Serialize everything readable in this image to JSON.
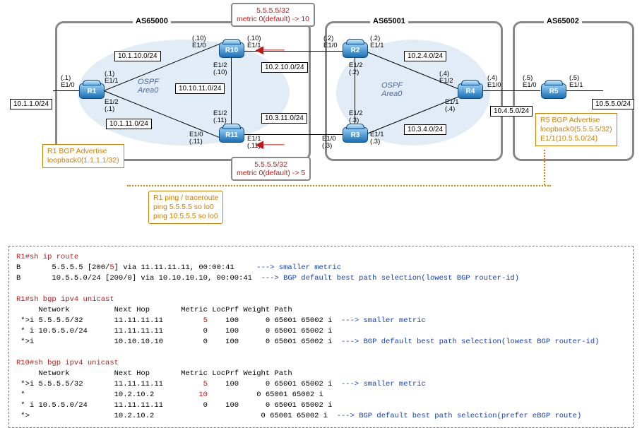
{
  "as": {
    "a": "AS65000",
    "b": "AS65001",
    "c": "AS65002"
  },
  "routers": {
    "r1": "R1",
    "r2": "R2",
    "r3": "R3",
    "r4": "R4",
    "r5": "R5",
    "r10": "R10",
    "r11": "R11"
  },
  "ospf": {
    "a": "OSPF\nArea0",
    "b": "OSPF\nArea0"
  },
  "nets": {
    "n1": "10.1.1.0/24",
    "n2": "10.1.10.0/24",
    "n3": "10.1.11.0/24",
    "n4": "10.10.11.0/24",
    "n5": "10.2.10.0/24",
    "n6": "10.3.11.0/24",
    "n7": "10.2.4.0/24",
    "n8": "10.3.4.0/24",
    "n9": "10.4.5.0/24",
    "n10": "10.5.5.0/24"
  },
  "ifaces": {
    "r1e10": "(.1)\nE1/0",
    "r1e11": "(.1)\nE1/1",
    "r1e12": "E1/2\n(.1)",
    "r10e10": "(.10)\nE1/0",
    "r10e11": "(.10)\nE1/1",
    "r10e12": "E1/2\n(.10)",
    "r11e10": "E1/0\n(.11)",
    "r11e11": "E1/1\n(.11)",
    "r11e12": "E1/2\n(.11)",
    "r2e10": "(.2)\nE1/0",
    "r2e11": "(.2)\nE1/1",
    "r2e12": "E1/2\n(.2)",
    "r3e10": "E1/0\n(.3)",
    "r3e11": "E1/1\n(.3)",
    "r3e12": "E1/2\n(.3)",
    "r4e10": "(.4)\nE1/0",
    "r4e11": "E1/1\n(.4)",
    "r4e12": "(.4)\nE1/2",
    "r5e10": "(.5)\nE1/0",
    "r5e11": "(.5)\nE1/1"
  },
  "notes": {
    "top": "5.5.5.5/32\nmetric 0(default) -> 10",
    "bot": "5.5.5.5/32\nmetric 0(default) -> 5"
  },
  "adv": {
    "r1": "R1 BGP Advertise\nloopback0(1.1.1.1/32)",
    "r5": "R5 BGP Advertise\nloopback0(5.5.5.5/32)\nE1/1(10.5.5.0/24)"
  },
  "ping": "R1 ping / traceroute\nping 5.5.5.5 so lo0\nping 10.5.5.5 so lo0",
  "cli": {
    "l1": "R1#sh ip route",
    "l2a": "B       5.5.5.5 [200/",
    "l2b": "5",
    "l2c": "] via 11.11.11.11, 00:00:41     ",
    "l2d": "---> smaller metric",
    "l3a": "B       10.5.5.0/24 [200/0] via 10.10.10.10, 00:00:41  ",
    "l3b": "---> BGP default best path selection(lowest BGP router-id)",
    "l4": "R1#sh bgp ipv4 unicast",
    "hd": "     Network          Next Hop       Metric LocPrf Weight Path",
    "l5a": " *>i 5.5.5.5/32       11.11.11.11         ",
    "l5b": "5",
    "l5c": "    100      0 65001 65002 i  ",
    "l5d": "---> smaller metric",
    "l6": " * i 10.5.5.0/24      11.11.11.11         0    100      0 65001 65002 i",
    "l7a": " *>i                  10.10.10.10         0    100      0 65001 65002 i  ",
    "l7b": "---> BGP default best path selection(lowest BGP router-id)",
    "l8": "R10#sh bgp ipv4 unicast",
    "l9a": " *>i 5.5.5.5/32       11.11.11.11         ",
    "l9b": "5",
    "l9c": "    100      0 65001 65002 i  ",
    "l9d": "---> smaller metric",
    "l10a": " *                    10.2.10.2          ",
    "l10b": "10",
    "l10c": "           0 65001 65002 i",
    "l11": " * i 10.5.5.0/24      11.11.11.11         0    100      0 65001 65002 i",
    "l12a": " *>                   10.2.10.2                        0 65001 65002 i  ",
    "l12b": "---> BGP default best path selection(prefer eBGP route)"
  },
  "chart_data": {
    "type": "table",
    "title": "BGP topology and route selection",
    "diagram": {
      "autonomous_systems": [
        {
          "name": "AS65000",
          "routers": [
            "R1",
            "R10",
            "R11"
          ],
          "igp": "OSPF Area0"
        },
        {
          "name": "AS65001",
          "routers": [
            "R2",
            "R3",
            "R4"
          ],
          "igp": "OSPF Area0"
        },
        {
          "name": "AS65002",
          "routers": [
            "R5"
          ]
        }
      ],
      "links": [
        {
          "net": "10.1.1.0/24",
          "endpoints": [
            {
              "r": "R1",
              "if": "E1/0",
              "ip": ".1"
            }
          ]
        },
        {
          "net": "10.1.10.0/24",
          "endpoints": [
            {
              "r": "R1",
              "if": "E1/1",
              "ip": ".1"
            },
            {
              "r": "R10",
              "if": "E1/0",
              "ip": ".10"
            }
          ]
        },
        {
          "net": "10.1.11.0/24",
          "endpoints": [
            {
              "r": "R1",
              "if": "E1/2",
              "ip": ".1"
            },
            {
              "r": "R11",
              "if": "E1/0",
              "ip": ".11"
            }
          ]
        },
        {
          "net": "10.10.11.0/24",
          "endpoints": [
            {
              "r": "R10",
              "if": "E1/2",
              "ip": ".10"
            },
            {
              "r": "R11",
              "if": "E1/2",
              "ip": ".11"
            }
          ]
        },
        {
          "net": "10.2.10.0/24",
          "endpoints": [
            {
              "r": "R10",
              "if": "E1/1",
              "ip": ".10"
            },
            {
              "r": "R2",
              "if": "E1/0",
              "ip": ".2"
            }
          ],
          "ebgp_metric": {
            "prefix": "5.5.5.5/32",
            "from": 0,
            "to": 10
          }
        },
        {
          "net": "10.3.11.0/24",
          "endpoints": [
            {
              "r": "R11",
              "if": "E1/1",
              "ip": ".11"
            },
            {
              "r": "R3",
              "if": "E1/0",
              "ip": ".3"
            }
          ],
          "ebgp_metric": {
            "prefix": "5.5.5.5/32",
            "from": 0,
            "to": 5
          }
        },
        {
          "net": "10.2.4.0/24",
          "endpoints": [
            {
              "r": "R2",
              "if": "E1/1",
              "ip": ".2"
            },
            {
              "r": "R4",
              "if": "E1/2",
              "ip": ".4"
            }
          ]
        },
        {
          "net": "10.3.4.0/24",
          "endpoints": [
            {
              "r": "R3",
              "if": "E1/1",
              "ip": ".3"
            },
            {
              "r": "R4",
              "if": "E1/1",
              "ip": ".4"
            }
          ]
        },
        {
          "net": "10.4.5.0/24",
          "endpoints": [
            {
              "r": "R4",
              "if": "E1/0",
              "ip": ".4"
            },
            {
              "r": "R5",
              "if": "E1/0",
              "ip": ".5"
            }
          ]
        },
        {
          "net": "10.5.5.0/24",
          "endpoints": [
            {
              "r": "R5",
              "if": "E1/1",
              "ip": ".5"
            }
          ]
        }
      ],
      "advertise": [
        {
          "router": "R1",
          "items": [
            "loopback0(1.1.1.1/32)"
          ]
        },
        {
          "router": "R5",
          "items": [
            "loopback0(5.5.5.5/32)",
            "E1/1(10.5.5.0/24)"
          ]
        }
      ],
      "tests": {
        "from": "R1",
        "cmds": [
          "ping 5.5.5.5 so lo0",
          "ping 10.5.5.5 so lo0"
        ]
      }
    },
    "r1_ip_route": [
      {
        "proto": "B",
        "dest": "5.5.5.5",
        "ad_metric": "200/5",
        "via": "11.11.11.11",
        "age": "00:00:41",
        "note": "smaller metric"
      },
      {
        "proto": "B",
        "dest": "10.5.5.0/24",
        "ad_metric": "200/0",
        "via": "10.10.10.10",
        "age": "00:00:41",
        "note": "BGP default best path selection(lowest BGP router-id)"
      }
    ],
    "r1_bgp": [
      {
        "status": "*>i",
        "network": "5.5.5.5/32",
        "next_hop": "11.11.11.11",
        "metric": 5,
        "locprf": 100,
        "weight": 0,
        "path": "65001 65002 i",
        "note": "smaller metric"
      },
      {
        "status": "* i",
        "network": "10.5.5.0/24",
        "next_hop": "11.11.11.11",
        "metric": 0,
        "locprf": 100,
        "weight": 0,
        "path": "65001 65002 i"
      },
      {
        "status": "*>i",
        "network": "",
        "next_hop": "10.10.10.10",
        "metric": 0,
        "locprf": 100,
        "weight": 0,
        "path": "65001 65002 i",
        "note": "BGP default best path selection(lowest BGP router-id)"
      }
    ],
    "r10_bgp": [
      {
        "status": "*>i",
        "network": "5.5.5.5/32",
        "next_hop": "11.11.11.11",
        "metric": 5,
        "locprf": 100,
        "weight": 0,
        "path": "65001 65002 i",
        "note": "smaller metric"
      },
      {
        "status": "*",
        "network": "",
        "next_hop": "10.2.10.2",
        "metric": 10,
        "locprf": "",
        "weight": 0,
        "path": "65001 65002 i"
      },
      {
        "status": "* i",
        "network": "10.5.5.0/24",
        "next_hop": "11.11.11.11",
        "metric": 0,
        "locprf": 100,
        "weight": 0,
        "path": "65001 65002 i"
      },
      {
        "status": "*>",
        "network": "",
        "next_hop": "10.2.10.2",
        "metric": "",
        "locprf": "",
        "weight": 0,
        "path": "65001 65002 i",
        "note": "BGP default best path selection(prefer eBGP route)"
      }
    ]
  }
}
